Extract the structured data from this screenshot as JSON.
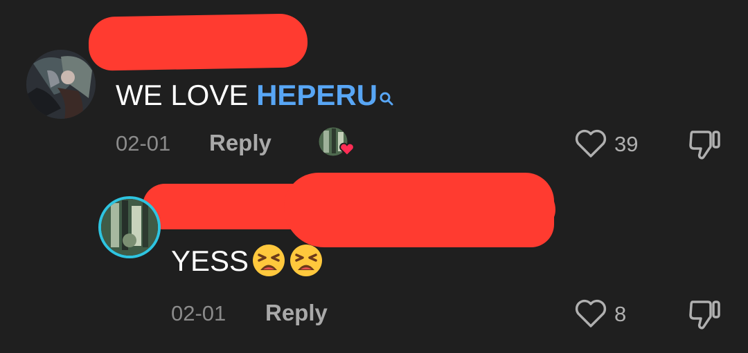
{
  "comments": [
    {
      "text_prefix": "WE LOVE ",
      "mention": "HEPERU",
      "date": "02-01",
      "reply_label": "Reply",
      "likes": "39",
      "creator_liked": true
    },
    {
      "text": "YESS",
      "emoji_count": 2,
      "emoji_name": "tired-face-emoji",
      "date": "02-01",
      "reply_label": "Reply",
      "likes": "8"
    }
  ],
  "colors": {
    "background": "#1f1f1f",
    "redaction": "#ff3b30",
    "mention": "#58a6f5",
    "meta_text": "#8b8b8b",
    "avatar_ring": "#2ec4e0"
  }
}
